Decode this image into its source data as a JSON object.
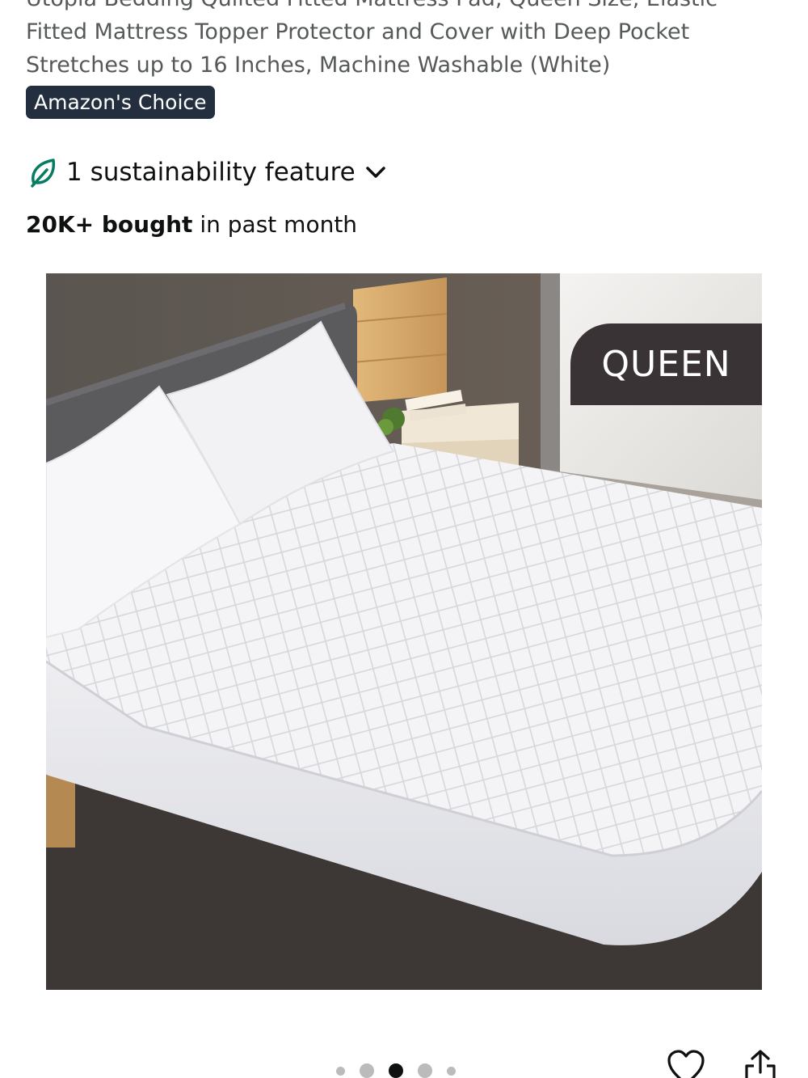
{
  "product": {
    "title_lines": [
      "Utopia Bedding Quilted Fitted Mattress Pad, Queen Size, Elastic",
      "Fitted Mattress Topper Protector and Cover with Deep Pocket",
      "Stretches up to 16 Inches, Machine Washable (White)"
    ],
    "badge": "Amazon's Choice",
    "sustainability": {
      "label": "1 sustainability feature",
      "icon": "leaf-icon",
      "expand_icon": "chevron-down-icon"
    },
    "social_proof": {
      "bold": "20K+ bought",
      "rest": " in past month"
    },
    "image": {
      "size_tag": "QUEEN"
    },
    "carousel": {
      "total_dots": 5,
      "active_index": 2
    },
    "actions": {
      "wishlist_icon": "heart-icon",
      "share_icon": "share-icon"
    }
  },
  "colors": {
    "badge_bg": "#232f3e",
    "leaf_green": "#067d62",
    "size_tag_bg": "#3a3335",
    "text_primary": "#0f1111",
    "text_secondary": "#565959"
  }
}
